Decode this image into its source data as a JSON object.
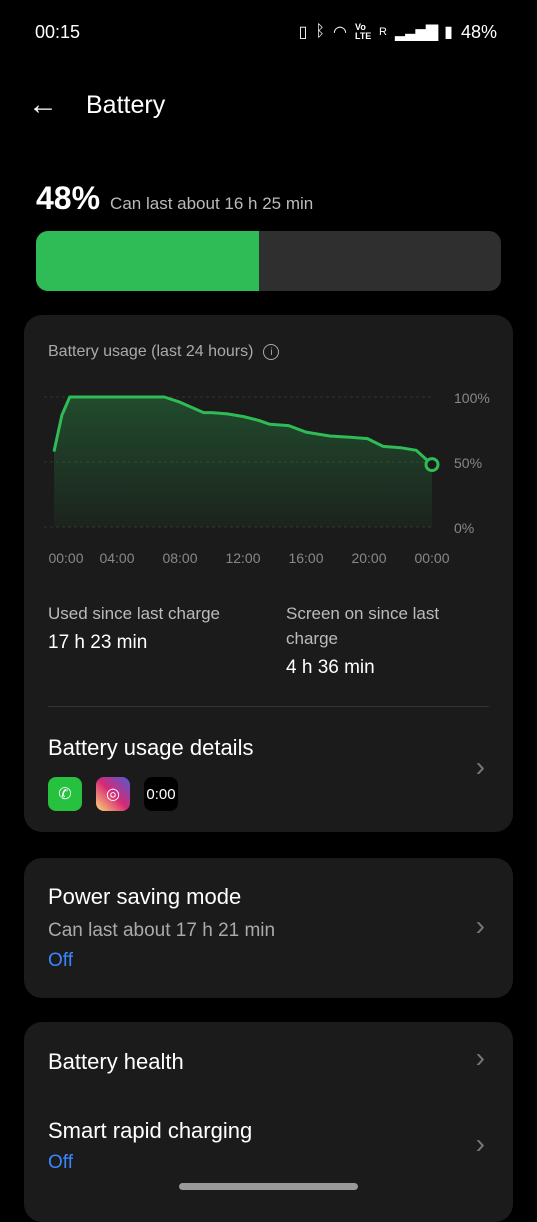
{
  "status": {
    "time": "00:15",
    "battery": "48%",
    "icons": [
      "vibrate-icon",
      "bluetooth-icon",
      "wifi-icon",
      "volte-icon",
      "signal-icon",
      "battery-icon"
    ],
    "volte": "Vo LTE",
    "roaming": "R"
  },
  "header": {
    "title": "Battery"
  },
  "battery": {
    "percent": "48%",
    "percent_value": 48,
    "estimate": "Can last about 16 h 25 min",
    "fill_color": "#2fbb55"
  },
  "usage": {
    "title": "Battery usage (last 24 hours)",
    "used_label": "Used since last charge",
    "used_value": "17 h 23 min",
    "screen_label": "Screen on since last charge",
    "screen_value": "4 h 36 min",
    "details_title": "Battery usage details",
    "apps": [
      {
        "icon": "whatsapp-icon",
        "color": "#25c13f"
      },
      {
        "icon": "instagram-icon",
        "color": "#d62976"
      },
      {
        "icon": "clock-app-icon",
        "text": "0:00"
      }
    ]
  },
  "chart_data": {
    "type": "area",
    "xlabel": "",
    "ylabel": "",
    "x_ticks": [
      "00:00",
      "04:00",
      "08:00",
      "12:00",
      "16:00",
      "20:00",
      "00:00"
    ],
    "y_ticks": [
      "100%",
      "50%",
      "0%"
    ],
    "ylim": [
      0,
      100
    ],
    "xlim_hours": [
      0,
      24
    ],
    "x_hours": [
      0,
      0.5,
      1,
      7,
      8,
      9.5,
      10,
      11,
      12,
      13,
      13.7,
      14.9,
      16,
      17.5,
      18.8,
      19.9,
      20.9,
      22,
      23,
      24
    ],
    "values": [
      58,
      86,
      100,
      100,
      96,
      88,
      88,
      87,
      85,
      82,
      79,
      78,
      73,
      70,
      69,
      68,
      62,
      61,
      59,
      48
    ],
    "line_color": "#2fbb55",
    "grid": "dashed-horizontal"
  },
  "power_saving": {
    "title": "Power saving mode",
    "subtitle": "Can last about 17 h 21 min",
    "state": "Off"
  },
  "health": {
    "title": "Battery health"
  },
  "rapid": {
    "title": "Smart rapid charging",
    "state": "Off"
  }
}
